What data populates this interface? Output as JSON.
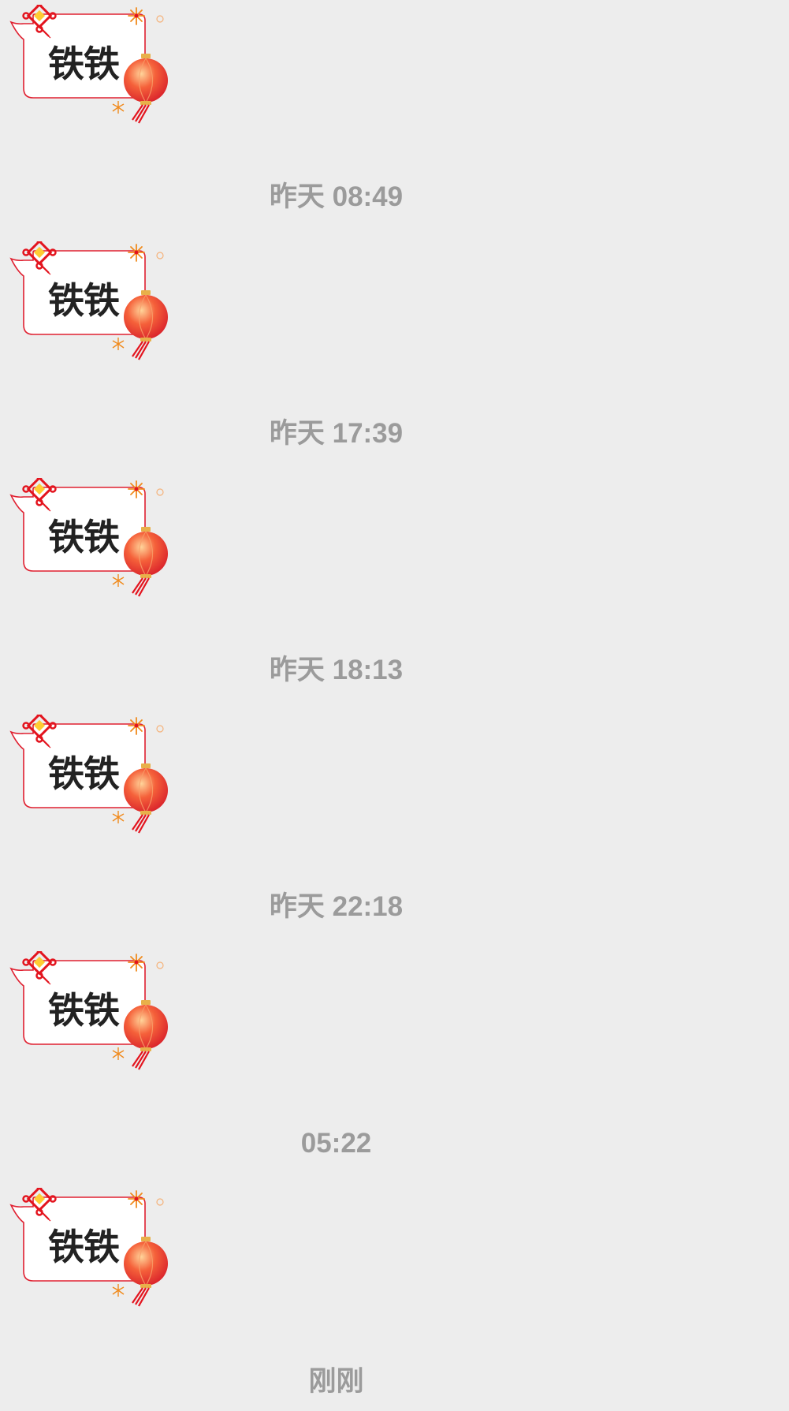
{
  "messages": [
    {
      "sticker_text": "铁铁"
    },
    {
      "timestamp": "昨天 08:49",
      "sticker_text": "铁铁"
    },
    {
      "timestamp": "昨天 17:39",
      "sticker_text": "铁铁"
    },
    {
      "timestamp": "昨天 18:13",
      "sticker_text": "铁铁"
    },
    {
      "timestamp": "昨天 22:18",
      "sticker_text": "铁铁"
    },
    {
      "timestamp": "05:22",
      "sticker_text": "铁铁"
    }
  ],
  "last_timestamp": "刚刚",
  "colors": {
    "background": "#ededed",
    "timestamp_text": "#9b9b9b",
    "bubble_border": "#e02030",
    "lantern": "#ee3b2c",
    "fireworks": "#f08a1c"
  },
  "icons": [
    "chinese-knot-icon",
    "fireworks-icon",
    "lantern-icon"
  ]
}
